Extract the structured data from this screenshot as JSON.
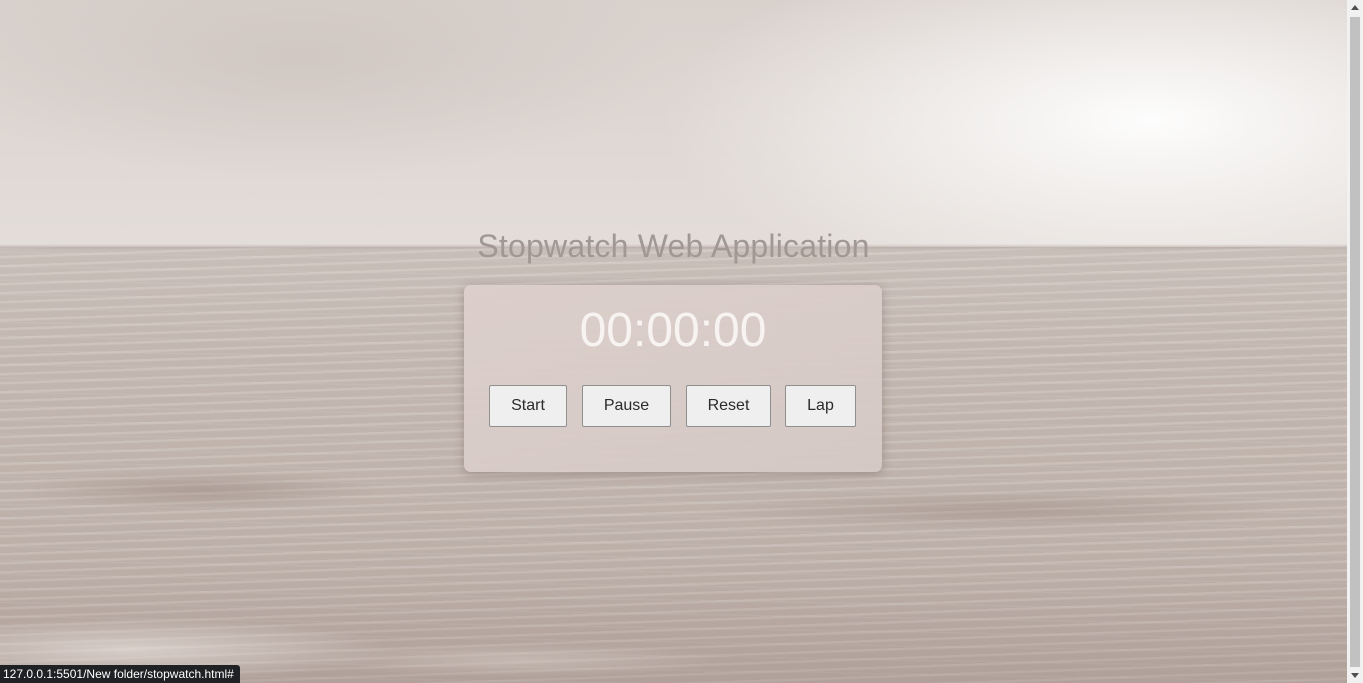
{
  "page": {
    "title": "Stopwatch Web Application"
  },
  "stopwatch": {
    "display": "00:00:00",
    "buttons": {
      "start": "Start",
      "pause": "Pause",
      "reset": "Reset",
      "lap": "Lap"
    }
  },
  "status_bar": {
    "url": "127.0.0.1:5501/New folder/stopwatch.html#"
  },
  "colors": {
    "title_text": "#a19894",
    "card_background": "#dcd0cc",
    "display_text": "#f7f3f1",
    "button_background": "#efefef",
    "status_bar_background": "#202124"
  }
}
